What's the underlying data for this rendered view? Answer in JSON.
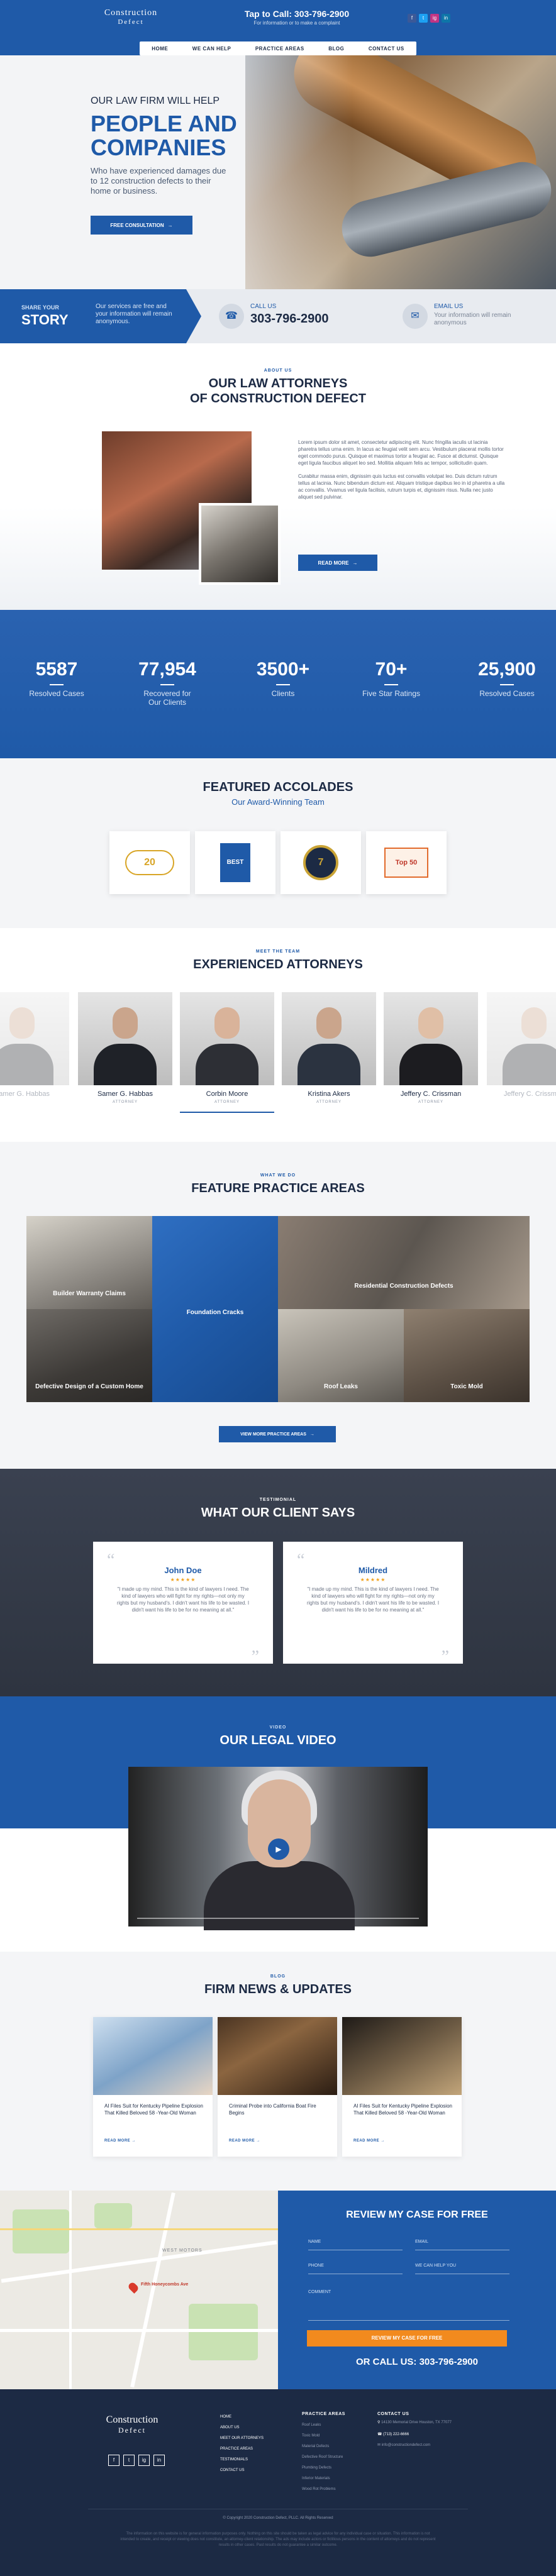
{
  "header": {
    "logo_line1": "Construction",
    "logo_line2": "Defect",
    "call_text": "Tap to Call: 303-796-2900",
    "call_sub": "For information or to make a complaint",
    "nav": [
      "HOME",
      "WE CAN HELP",
      "PRACTICE AREAS",
      "BLOG",
      "CONTACT US"
    ],
    "social": [
      "f",
      "t",
      "ig",
      "in"
    ]
  },
  "hero": {
    "kicker": "OUR LAW FIRM WILL HELP",
    "title_line1": "PEOPLE AND",
    "title_line2": "COMPANIES",
    "subtitle": "Who have experienced damages due to 12 construction defects to their home or business.",
    "button": "FREE CONSULTATION"
  },
  "story": {
    "kicker": "SHARE YOUR",
    "title": "STORY",
    "desc": "Our services are free and your information will remain anonymous.",
    "call_label": "CALL US",
    "call_value": "303-796-2900",
    "email_label": "EMAIL US",
    "email_value": "Your information will remain anonymous"
  },
  "about": {
    "kicker": "ABOUT US",
    "title_line1": "OUR LAW ATTORNEYS",
    "title_line2": "OF CONSTRUCTION DEFECT",
    "p1": "Lorem ipsum dolor sit amet, consectetur adipiscing elit. Nunc fringilla iaculis ut lacinia pharetra tellus urna enim. In lacus ac feugiat velit sem arcu. Vestibulum placerat mollis tortor eget commodo purus. Quisque et maximus tortor a feugiat ac. Fusce at dictumst. Quisque eget ligula faucibus aliquet leo sed. Mollitia aliquam felis ac tempor, sollicitudin quam.",
    "p2": "Curabitur massa enim, dignissim quis luctus est convallis volutpat leo. Duis dictum rutrum tellus at lacinia. Nunc bibendum dictum est. Aliquam tristique dapibus leo in id pharetra a ulla ac convallis. Vivamus vel ligula facilisis, rutrum turpis et, dignissim risus. Nulla nec justo aliquet sed pulvinar.",
    "button": "READ MORE"
  },
  "stats": [
    {
      "value": "5587",
      "label": "Resolved Cases"
    },
    {
      "value": "77,954",
      "label": "Recovered for Our Clients"
    },
    {
      "value": "3500+",
      "label": "Clients"
    },
    {
      "value": "70+",
      "label": "Five Star Ratings"
    },
    {
      "value": "25,900",
      "label": "Resolved Cases"
    }
  ],
  "accolades": {
    "title": "FEATURED ACCOLADES",
    "subtitle": "Our Award-Winning Team",
    "badges": [
      "20",
      "BEST",
      "7",
      "Top 50"
    ]
  },
  "attorneys": {
    "kicker": "MEET THE TEAM",
    "title": "EXPERIENCED ATTORNEYS",
    "people": [
      {
        "name": "Samer G. Habbas",
        "role": "ATTORNEY"
      },
      {
        "name": "Corbin Moore",
        "role": "ATTORNEY"
      },
      {
        "name": "Kristina Akers",
        "role": "ATTORNEY"
      },
      {
        "name": "Jeffery C. Crissman",
        "role": "ATTORNEY"
      }
    ],
    "faded_left": "Samer G. Habbas",
    "faded_right": "Jeffery C. Crissman"
  },
  "practice": {
    "kicker": "WHAT WE DO",
    "title": "FEATURE PRACTICE AREAS",
    "tiles": [
      "Builder Warranty Claims",
      "Foundation Cracks",
      "Residential Construction Defects",
      "Defective Design of a Custom Home",
      "Roof Leaks",
      "Toxic Mold"
    ],
    "button": "VIEW MORE PRACTICE AREAS"
  },
  "testimonials": {
    "kicker": "TESTIMONIAL",
    "title": "WHAT OUR CLIENT SAYS",
    "items": [
      {
        "name": "John Doe",
        "stars": "★★★★★",
        "text": "\"I made up my mind. This is the kind of lawyers I need. The kind of lawyers who will fight for my rights—not only my rights but my husband's. I didn't want his life to be wasted. I didn't want his life to be for no meaning at all.\""
      },
      {
        "name": "Mildred",
        "stars": "★★★★★",
        "text": "\"I made up my mind. This is the kind of lawyers I need. The kind of lawyers who will fight for my rights—not only my rights but my husband's. I didn't want his life to be wasted. I didn't want his life to be for no meaning at all.\""
      }
    ]
  },
  "video": {
    "kicker": "VIDEO",
    "title": "OUR LEGAL VIDEO"
  },
  "news": {
    "kicker": "BLOG",
    "title": "FIRM NEWS & UPDATES",
    "items": [
      {
        "title": "AI Files Suit for Kentucky Pipeline Explosion That Killed Beloved 58 -Year-Old Woman",
        "more": "READ MORE"
      },
      {
        "title": "Criminal Probe into California Boat Fire Begins",
        "more": "READ MORE"
      },
      {
        "title": "AI Files Suit for Kentucky Pipeline Explosion That Killed Beloved 58 -Year-Old Woman",
        "more": "READ MORE"
      }
    ]
  },
  "map": {
    "label": "Fifth Honeycombs Ave",
    "street": "WEST MOTORS"
  },
  "form": {
    "title": "REVIEW MY CASE FOR FREE",
    "name": "NAME",
    "email": "EMAIL",
    "phone": "PHONE",
    "help": "WE CAN HELP YOU",
    "comment": "COMMENT",
    "button": "REVIEW MY CASE FOR FREE",
    "call": "OR CALL US: 303-796-2900"
  },
  "footer": {
    "logo_line1": "Construction",
    "logo_line2": "Defect",
    "col1": [
      "HOME",
      "ABOUT US",
      "MEET OUR ATTORNEYS",
      "PRACTICE AREAS",
      "TESTIMONIALS",
      "CONTACT US"
    ],
    "col2_head": "PRACTICE AREAS",
    "col2": [
      "Roof Leaks",
      "Toxic Mold",
      "Material Defects",
      "Defective Roof Structure",
      "Plumbing Defects",
      "Inferior Materials",
      "Wood Rot Problems"
    ],
    "col3_head": "CONTACT US",
    "address": "14130 Memorial Drive Houston, TX 77077",
    "phone": "(713) 222-6666",
    "email": "info@constructiondefect.com",
    "copyright": "© Copyright 2020 Construction Defect, PLLC. All Rights Reserved",
    "disclaimer": "The information on this website is for general information purposes only. Nothing on this site should be taken as legal advice for any individual case or situation. This information is not intended to create, and receipt or viewing does not constitute, an attorney-client relationship. The ads may include actors or fictitious persons in the content of attorneys and do not represent results in other cases. Past results do not guarantee a similar outcome."
  },
  "colors": {
    "brand_blue": "#1f5aa8",
    "navy": "#1c2a44",
    "accent_orange": "#f28a1e"
  }
}
